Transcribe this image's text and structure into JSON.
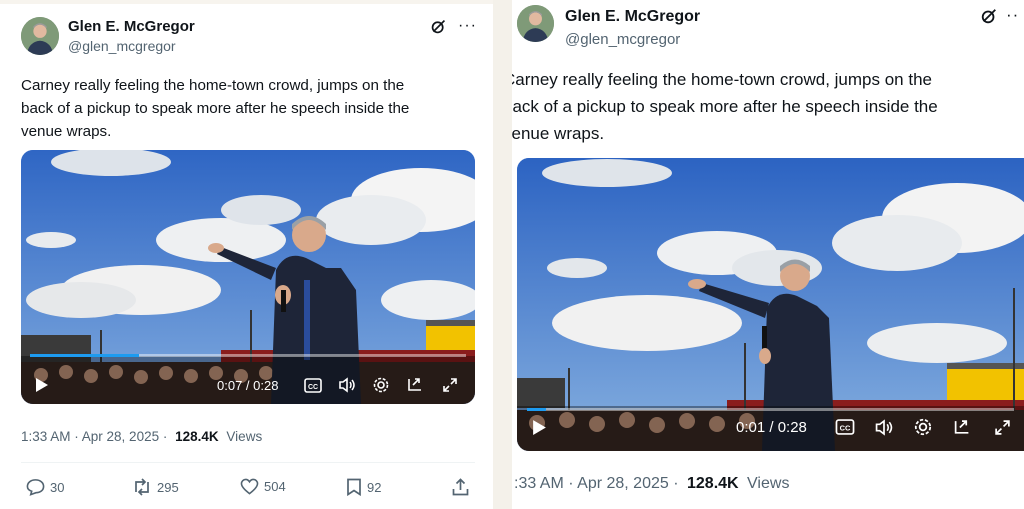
{
  "tweet": {
    "author_name": "Glen E. McGregor",
    "author_handle": "@glen_mcgregor",
    "text_lines": [
      "Carney really feeling the home-town crowd, jumps on the",
      "back of a pickup to speak more after he speech inside the",
      "venue wraps."
    ],
    "text_lines_cropped": [
      "Carney really feeling the home-town crowd, jumps on the",
      "back of a pickup to speak more after he speech inside the",
      "venue wraps."
    ],
    "timestamp": "1:33 AM · Apr 28, 2025 ·",
    "timestamp_cropped": ":33 AM · Apr 28, 2025 ·",
    "views_count": "128.4K",
    "views_label": "Views"
  },
  "left_video": {
    "time": "0:07 / 0:28",
    "progress_fraction": 0.25
  },
  "right_video": {
    "time": "0:01 / 0:28",
    "progress_fraction": 0.04
  },
  "actions": {
    "replies": "30",
    "reposts": "295",
    "likes": "504",
    "bookmarks": "92"
  },
  "icons": [
    "grok-icon",
    "more-icon",
    "play-icon",
    "captions-icon",
    "volume-icon",
    "settings-icon",
    "pip-icon",
    "fullscreen-icon",
    "reply-icon",
    "repost-icon",
    "like-icon",
    "bookmark-icon",
    "share-icon"
  ],
  "colors": {
    "accent": "#1d9bf0",
    "text": "#0f1419",
    "muted": "#536471"
  }
}
